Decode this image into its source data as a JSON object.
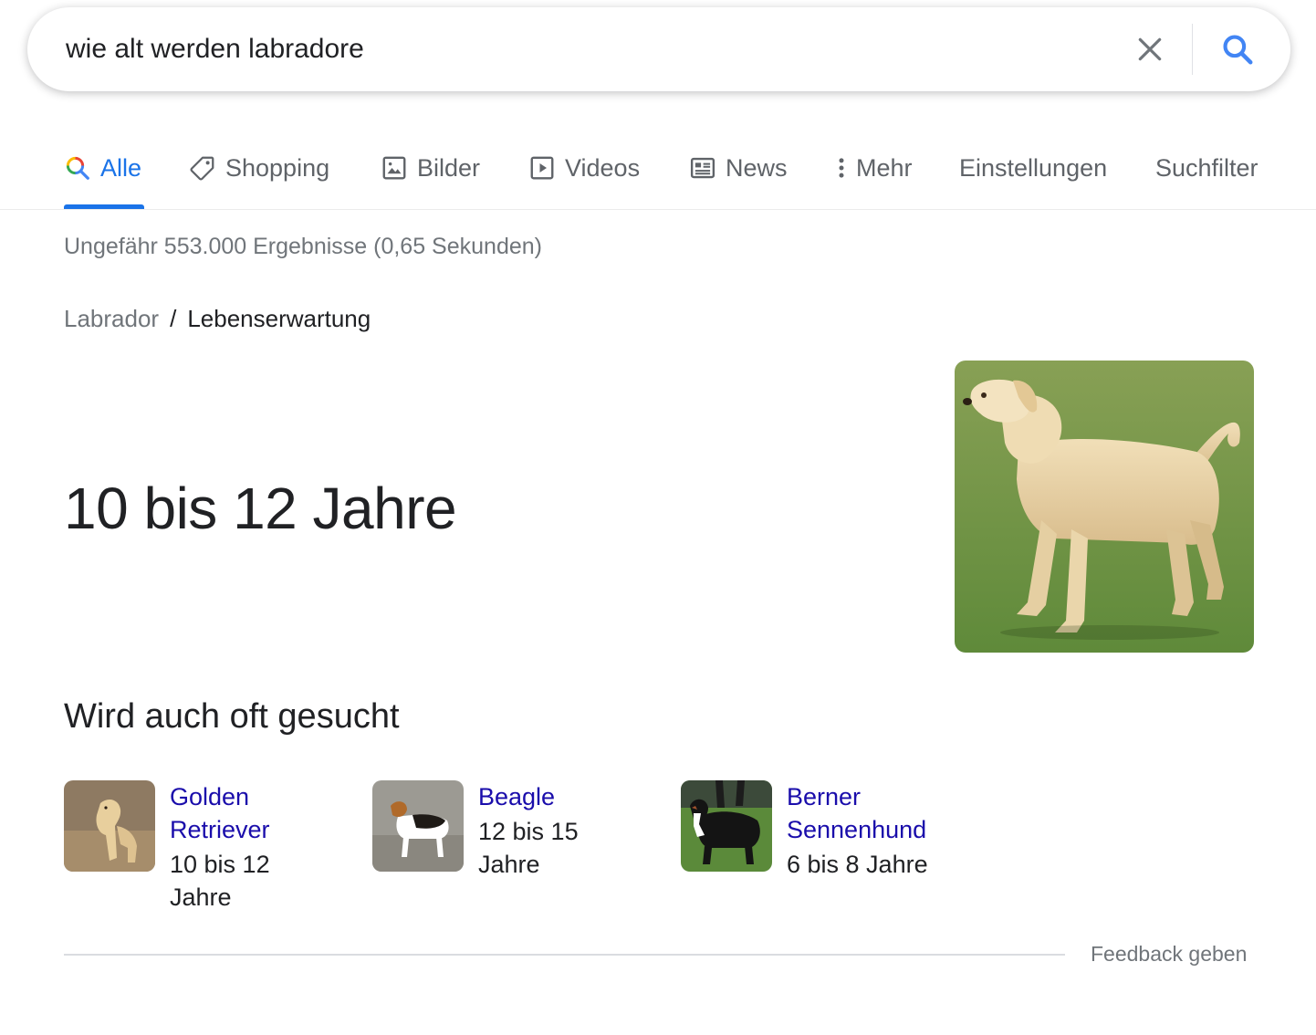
{
  "search": {
    "query": "wie alt werden labradore"
  },
  "tabs": [
    {
      "label": "Alle"
    },
    {
      "label": "Shopping"
    },
    {
      "label": "Bilder"
    },
    {
      "label": "Videos"
    },
    {
      "label": "News"
    },
    {
      "label": "Mehr"
    },
    {
      "label": "Einstellungen"
    },
    {
      "label": "Suchfilter"
    }
  ],
  "stats": "Ungefähr 553.000 Ergebnisse (0,65 Sekunden)",
  "breadcrumb": {
    "root": "Labrador",
    "separator": "/",
    "current": "Lebenserwartung"
  },
  "answer": "10 bis 12 Jahre",
  "also_searched": {
    "heading": "Wird auch oft gesucht",
    "items": [
      {
        "name_line1": "Golden",
        "name_line2": "Retriever",
        "value_line1": "10 bis 12",
        "value_line2": "Jahre"
      },
      {
        "name_line1": "Beagle",
        "value_line1": "12 bis 15",
        "value_line2": "Jahre"
      },
      {
        "name_line1": "Berner",
        "name_line2": "Sennenhund",
        "value_line1": "6 bis 8 Jahre"
      }
    ]
  },
  "feedback": "Feedback geben",
  "colors": {
    "accent": "#1a73e8",
    "link": "#1a0dab",
    "muted": "#70757a"
  }
}
